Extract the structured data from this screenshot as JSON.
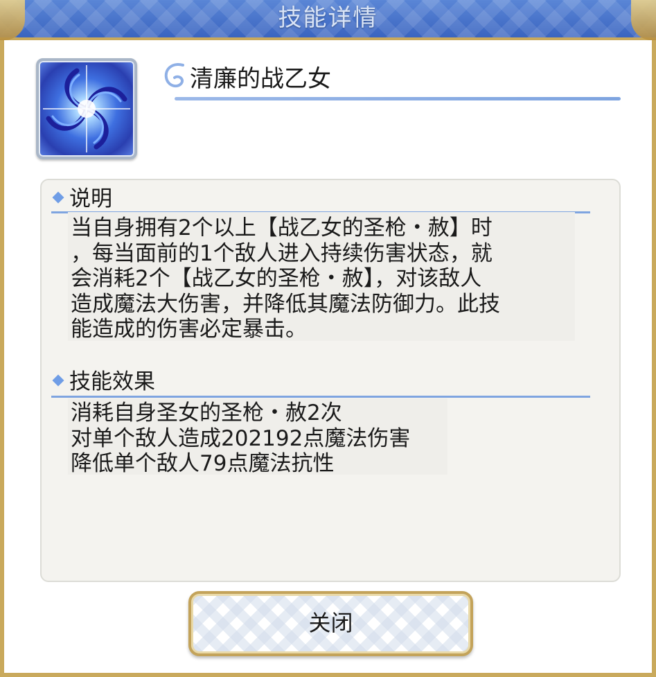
{
  "dialog": {
    "title": "技能详情",
    "skill_icon": "vortex-skill-icon",
    "skill_name": "清廉的战乙女"
  },
  "description": {
    "heading": "说明",
    "lines": [
      "当自身拥有2个以上【战乙女的圣枪・赦】时",
      "，每当面前的1个敌人进入持续伤害状态，就",
      "会消耗2个【战乙女的圣枪・赦】，对该敌人",
      "造成魔法大伤害，并降低其魔法防御力。此技",
      "能造成的伤害必定暴击。"
    ]
  },
  "effects": {
    "heading": "技能效果",
    "lines": [
      "消耗自身圣女的圣枪・赦2次",
      "对单个敌人造成202192点魔法伤害",
      "降低单个敌人79点魔法抗性"
    ]
  },
  "footer": {
    "close_label": "关闭"
  },
  "colors": {
    "title_bar": "#3a64c0",
    "frame_gold": "#c9a95c",
    "accent_line": "#7ea4e0",
    "panel_bg": "#f4f3ef"
  }
}
